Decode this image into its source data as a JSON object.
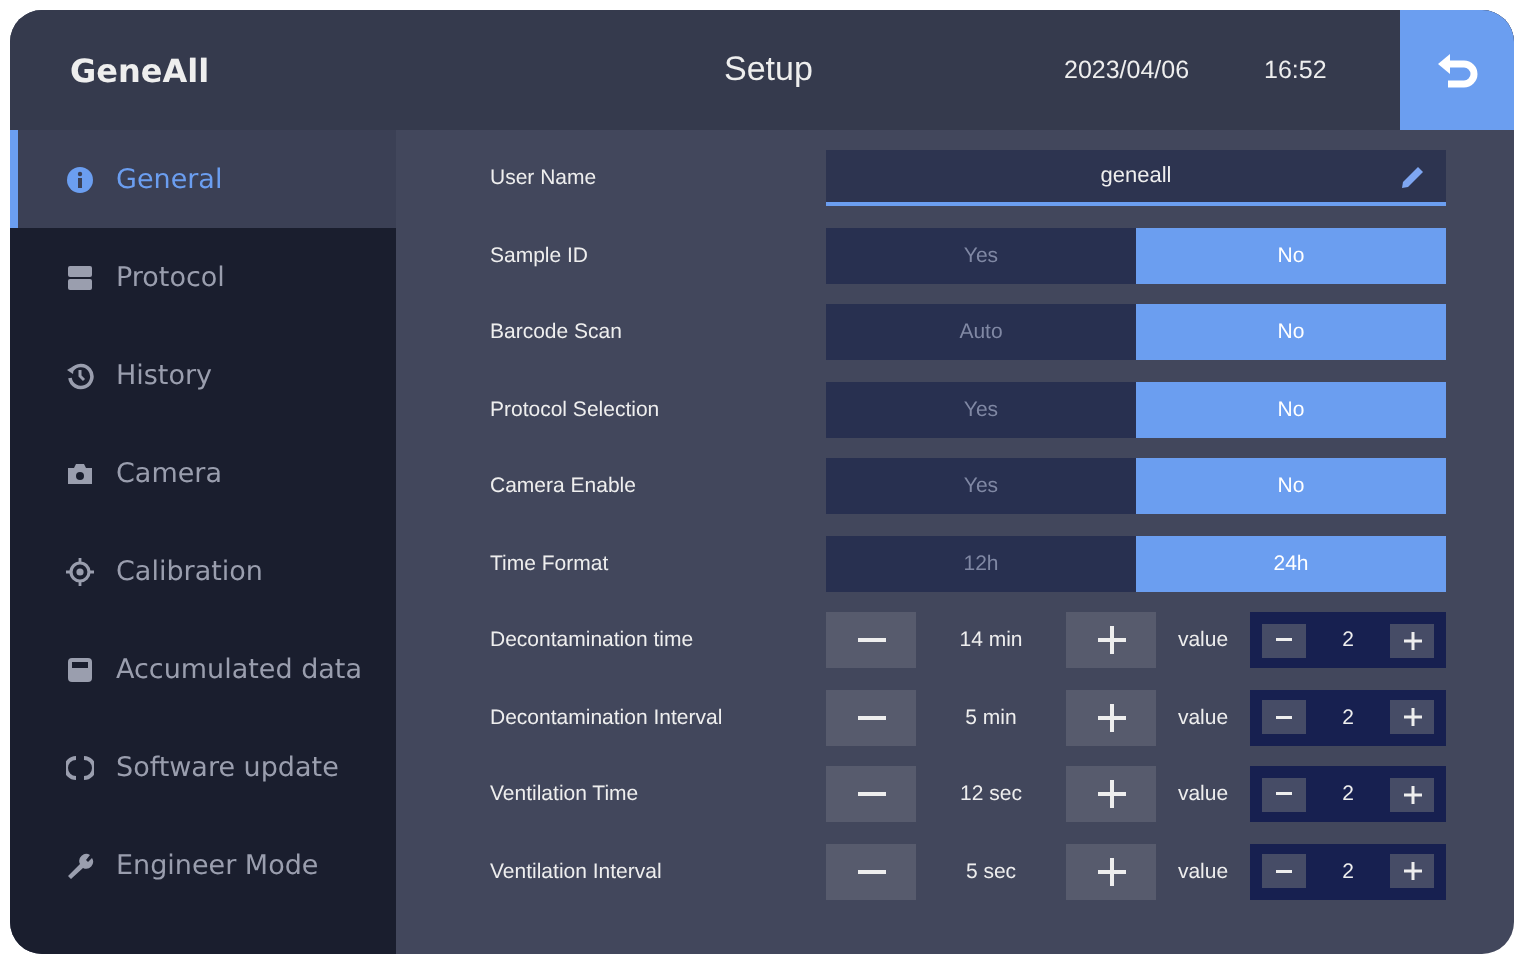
{
  "header": {
    "logo": "GeneAll",
    "title": "Setup",
    "date": "2023/04/06",
    "time": "16:52"
  },
  "sidebar": {
    "items": [
      {
        "label": "General",
        "selected": true
      },
      {
        "label": "Protocol",
        "selected": false
      },
      {
        "label": "History",
        "selected": false
      },
      {
        "label": "Camera",
        "selected": false
      },
      {
        "label": "Calibration",
        "selected": false
      },
      {
        "label": "Accumulated data",
        "selected": false
      },
      {
        "label": "Software update",
        "selected": false
      },
      {
        "label": "Engineer Mode",
        "selected": false
      }
    ]
  },
  "settings": [
    {
      "kind": "text",
      "label": "User Name",
      "value": "geneall"
    },
    {
      "kind": "toggle",
      "label": "Sample ID",
      "options": [
        {
          "label": "Yes",
          "selected": false
        },
        {
          "label": "No",
          "selected": true
        }
      ]
    },
    {
      "kind": "toggle",
      "label": "Barcode Scan",
      "options": [
        {
          "label": "Auto",
          "selected": false
        },
        {
          "label": "No",
          "selected": true
        }
      ]
    },
    {
      "kind": "toggle",
      "label": "Protocol Selection",
      "options": [
        {
          "label": "Yes",
          "selected": false
        },
        {
          "label": "No",
          "selected": true
        }
      ]
    },
    {
      "kind": "toggle",
      "label": "Camera Enable",
      "options": [
        {
          "label": "Yes",
          "selected": false
        },
        {
          "label": "No",
          "selected": true
        }
      ]
    },
    {
      "kind": "toggle",
      "label": "Time Format",
      "options": [
        {
          "label": "12h",
          "selected": false
        },
        {
          "label": "24h",
          "selected": true
        }
      ]
    },
    {
      "kind": "stepper",
      "label": "Decontamination time",
      "value": "14 min",
      "extra_label": "value",
      "extra_value": "2"
    },
    {
      "kind": "stepper",
      "label": "Decontamination Interval",
      "value": "5 min",
      "extra_label": "value",
      "extra_value": "2"
    },
    {
      "kind": "stepper",
      "label": "Ventilation Time",
      "value": "12 sec",
      "extra_label": "value",
      "extra_value": "2"
    },
    {
      "kind": "stepper",
      "label": "Ventilation  Interval",
      "value": "5 sec",
      "extra_label": "value",
      "extra_value": "2"
    }
  ]
}
